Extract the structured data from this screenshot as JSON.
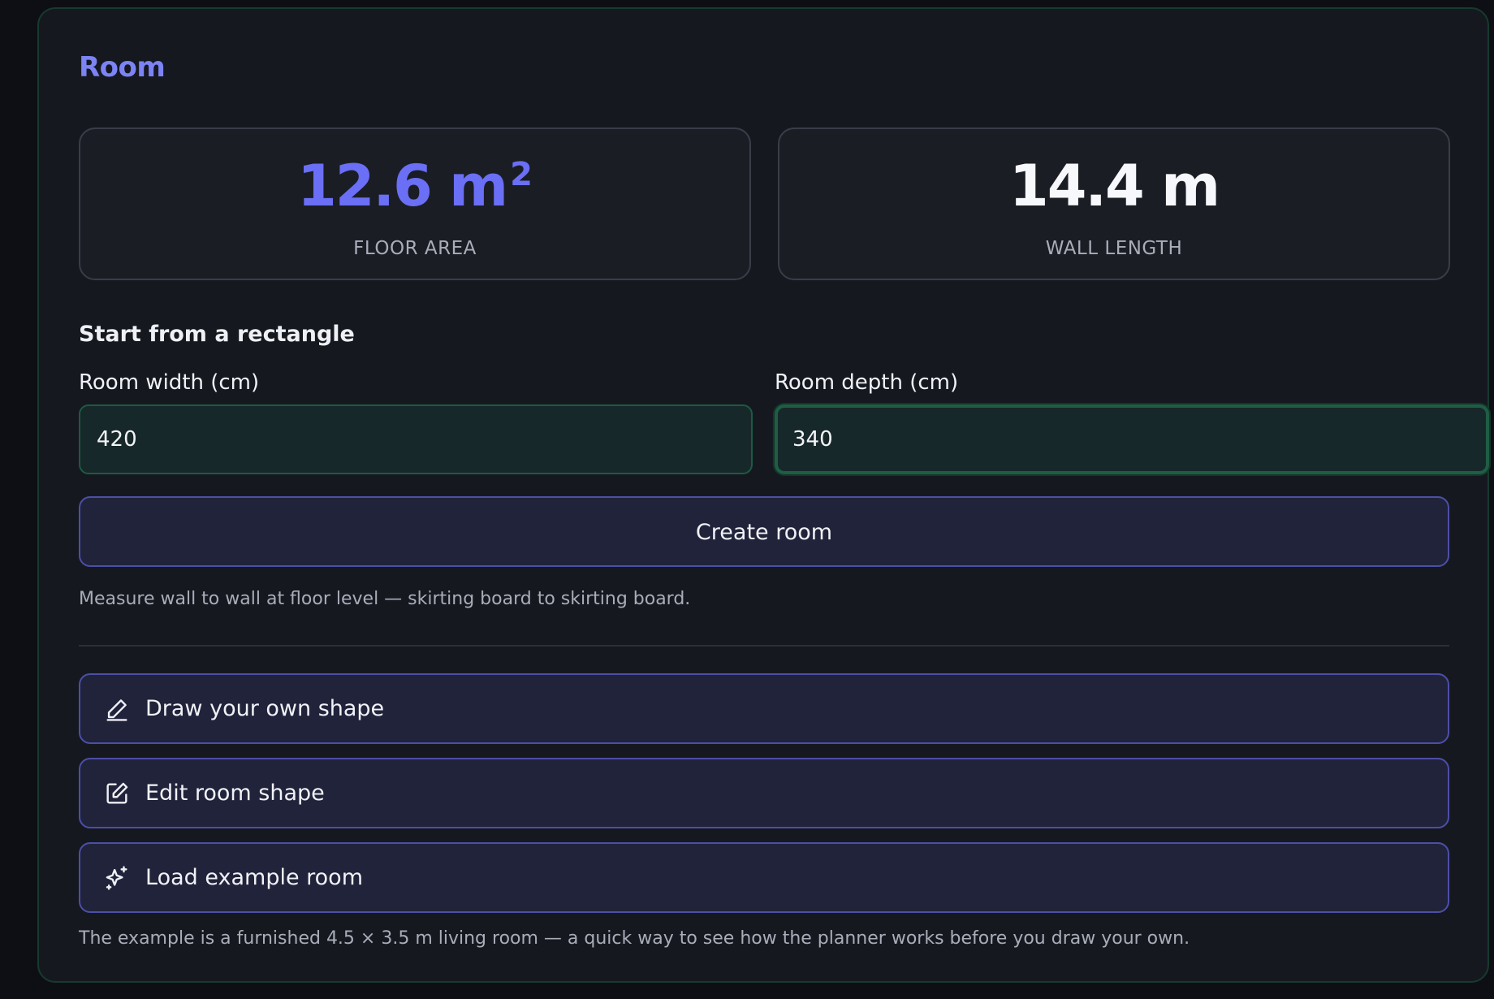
{
  "panel": {
    "title": "Room"
  },
  "stats": {
    "floor_area": {
      "value": "12.6 m",
      "superscript": "2",
      "label": "FLOOR AREA"
    },
    "wall_length": {
      "value": "14.4 m",
      "label": "WALL LENGTH"
    }
  },
  "rectangle": {
    "heading": "Start from a rectangle",
    "width_label": "Room width (cm)",
    "width_value": "420",
    "depth_label": "Room depth (cm)",
    "depth_value": "340",
    "create_label": "Create room",
    "hint": "Measure wall to wall at floor level — skirting board to skirting board."
  },
  "actions": {
    "draw_label": "Draw your own shape",
    "edit_label": "Edit room shape",
    "load_label": "Load example room",
    "hint": "The example is a furnished 4.5 × 3.5 m living room — a quick way to see how the planner works before you draw your own."
  },
  "icons": {
    "draw": "pencil-icon",
    "edit": "edit-square-icon",
    "load": "sparkles-icon"
  },
  "colors": {
    "accent": "#7c83f5",
    "floor_area": "#6a6ff5",
    "focus_border": "#1f5d45",
    "button_border": "#4c4fa6"
  }
}
